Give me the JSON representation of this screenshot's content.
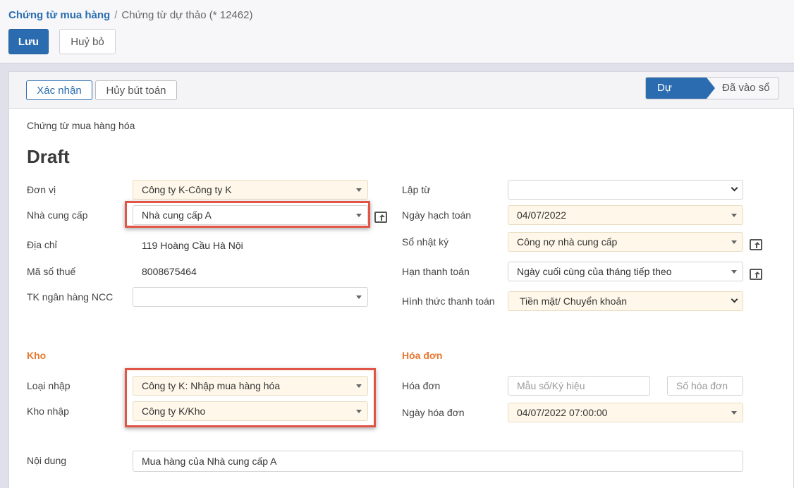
{
  "breadcrumb": {
    "parent": "Chứng từ mua hàng",
    "separator": "/",
    "current": "Chứng từ dự thảo (* 12462)"
  },
  "toolbar": {
    "save_label": "Lưu",
    "cancel_label": "Huỷ bỏ"
  },
  "statusbar": {
    "confirm_label": "Xác nhận",
    "void_label": "Hủy bút toán",
    "stage_draft": "Dự thảo",
    "stage_posted": "Đã vào sổ"
  },
  "doc": {
    "type": "Chứng từ mua hàng hóa",
    "title": "Draft"
  },
  "left": {
    "unit_label": "Đơn vị",
    "unit_value": "Công ty K-Công ty K",
    "supplier_label": "Nhà cung cấp",
    "supplier_value": "Nhà cung cấp A",
    "address_label": "Địa chỉ",
    "address_value": "119 Hoàng Cầu Hà Nội",
    "tax_label": "Mã số thuế",
    "tax_value": "8008675464",
    "bank_label": "TK ngân hàng NCC",
    "bank_value": ""
  },
  "right": {
    "from_label": "Lập từ",
    "from_value": "",
    "date_label": "Ngày hạch toán",
    "date_value": "04/07/2022",
    "journal_label": "Sổ nhật ký",
    "journal_value": "Công nợ nhà cung cấp",
    "due_label": "Hạn thanh toán",
    "due_value": "Ngày cuối cùng của tháng tiếp theo",
    "method_label": "Hình thức thanh toán",
    "method_value": "Tiền mặt/ Chuyển khoản"
  },
  "warehouse": {
    "section": "Kho",
    "type_label": "Loại nhập",
    "type_value": "Công ty K: Nhập mua hàng hóa",
    "store_label": "Kho nhập",
    "store_value": "Công ty K/Kho"
  },
  "invoice": {
    "section": "Hóa đơn",
    "invoice_label": "Hóa đơn",
    "form_placeholder": "Mẫu số/Ký hiệu",
    "number_placeholder": "Số hóa đơn",
    "date_label": "Ngày hóa đơn",
    "date_value": "04/07/2022 07:00:00"
  },
  "content": {
    "label": "Nội dung",
    "value": "Mua hàng của Nhà cung cấp A"
  },
  "colors": {
    "primary": "#2b6cb0",
    "section": "#e8772e",
    "required_bg": "#fff8ea",
    "highlight": "#e05545"
  }
}
